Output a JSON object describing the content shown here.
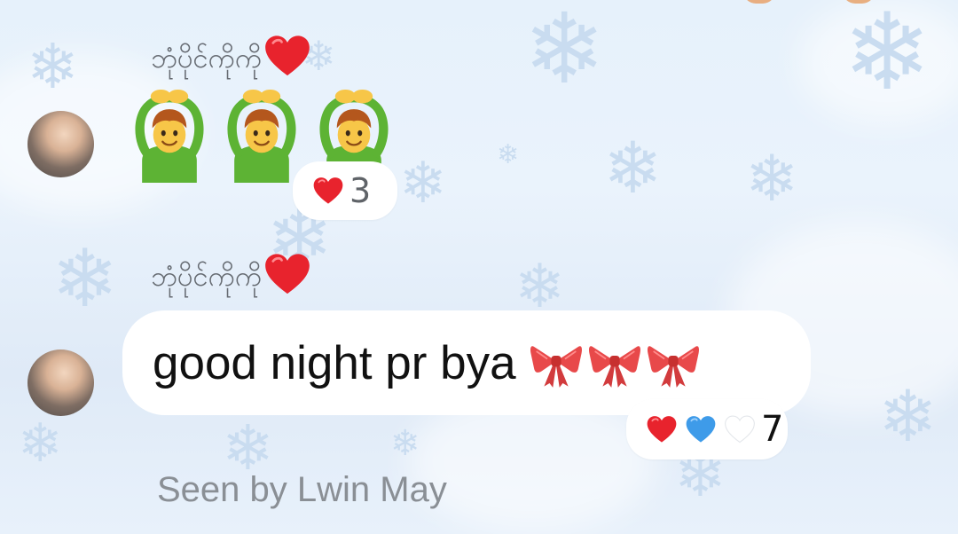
{
  "messages": [
    {
      "sender_name": "ဘုံပိုင်ကိုကို",
      "sender_suffix_icon": "red-heart-icon",
      "content_type": "emoji",
      "emojis": [
        "man-gesturing-ok-icon",
        "man-gesturing-ok-icon",
        "man-gesturing-ok-icon"
      ],
      "reactions": {
        "icons": [
          "red-heart-icon"
        ],
        "count": "3"
      }
    },
    {
      "sender_name": "ဘုံပိုင်ကိုကို",
      "sender_suffix_icon": "red-heart-icon",
      "content_type": "text",
      "text": "good night pr bya",
      "trailing_emojis": [
        "ribbon-icon",
        "ribbon-icon",
        "ribbon-icon"
      ],
      "reactions": {
        "icons": [
          "red-heart-icon",
          "blue-heart-icon",
          "white-heart-icon"
        ],
        "count": "7"
      }
    }
  ],
  "seen_status": "Seen by Lwin May",
  "colors": {
    "background": "#e6f1fb",
    "bubble": "#ffffff",
    "heart_red": "#e8232d",
    "heart_blue": "#3e9be9",
    "ribbon_red": "#e8494a"
  }
}
